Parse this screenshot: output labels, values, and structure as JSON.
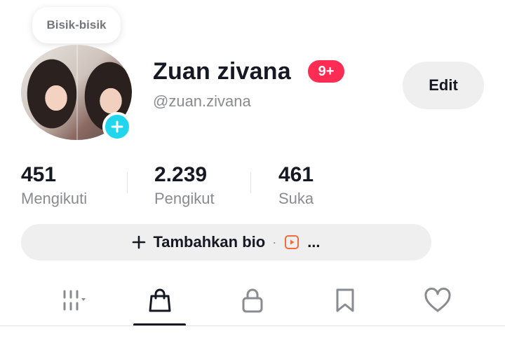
{
  "profile": {
    "bubble_text": "Bisik-bisik",
    "display_name": "Zuan zivana",
    "notification_badge": "9+",
    "username": "@zuan.zivana",
    "edit_label": "Edit"
  },
  "stats": [
    {
      "value": "451",
      "label": "Mengikuti"
    },
    {
      "value": "2.239",
      "label": "Pengikut"
    },
    {
      "value": "461",
      "label": "Suka"
    }
  ],
  "bio": {
    "add_label": "Tambahkan bio",
    "separator": "·",
    "more": "..."
  },
  "tabs": [
    {
      "icon": "grid-icon"
    },
    {
      "icon": "shopping-bag-icon",
      "active": true
    },
    {
      "icon": "lock-icon"
    },
    {
      "icon": "bookmark-icon"
    },
    {
      "icon": "heart-icon"
    }
  ],
  "colors": {
    "badge": "#fe2c55",
    "avatar_plus": "#20d5ec",
    "text_primary": "#161823",
    "text_secondary": "#8a8b91",
    "play_accent": "#f26b3a"
  }
}
